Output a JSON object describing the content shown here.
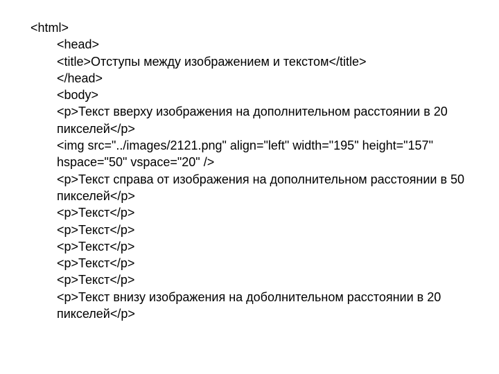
{
  "code": {
    "l01": "<html>",
    "l02": "<head>",
    "l03a": "<title>",
    "l03b": "Отступы между изображением и текстом",
    "l03c": "</title>",
    "l04": "</head>",
    "l05": "<body>",
    "l06": "<p>Текст вверху изображения на дополнительном расстоянии в 20 пикселей</p>",
    "l07": "<img src=\"../images/2121.png\" align=\"left\" width=\"195\" height=\"157\" hspace=\"50\" vspace=\"20\" />",
    "l08": "<p>Текст справа от изображения на дополнительном расстоянии в 50 пикселей</p>",
    "l09": "<p>Текст</p>",
    "l10": "<p>Текст</p>",
    "l11": "<p>Текст</p>",
    "l12": "<p>Текст</p>",
    "l13": "<p>Текст</p>",
    "l14": "<p>Текст внизу изображения на доболнительном расстоянии в 20 пикселей</p>"
  }
}
